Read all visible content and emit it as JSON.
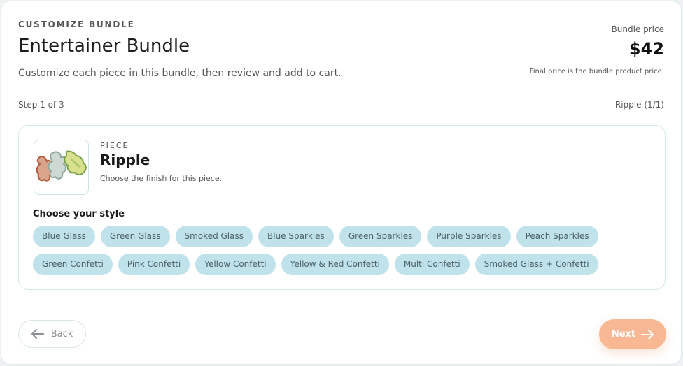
{
  "header": {
    "eyebrow": "CUSTOMIZE BUNDLE",
    "title": "Entertainer Bundle",
    "subtitle": "Customize each piece in this bundle, then review and add to cart.",
    "price_label": "Bundle price",
    "price": "$42",
    "price_note": "Final price is the bundle product price."
  },
  "progress": {
    "step_text": "Step 1 of 3",
    "piece_counter": "Ripple (1/1)"
  },
  "piece": {
    "eyebrow": "PIECE",
    "name": "Ripple",
    "description": "Choose the finish for this piece.",
    "style_label": "Choose your style",
    "styles_row1": [
      "Blue Glass",
      "Green Glass",
      "Smoked Glass",
      "Blue Sparkles",
      "Green Sparkles",
      "Purple Sparkles",
      "Peach Sparkles"
    ],
    "styles_row2": [
      "Green Confetti",
      "Pink Confetti",
      "Yellow Confetti",
      "Yellow & Red Confetti",
      "Multi Confetti",
      "Smoked Glass + Confetti"
    ]
  },
  "footer": {
    "back_label": "Back",
    "next_label": "Next"
  },
  "colors": {
    "chip_bg": "#bfe2eb",
    "next_bg": "#f9b894",
    "border": "#d3e7ea"
  }
}
